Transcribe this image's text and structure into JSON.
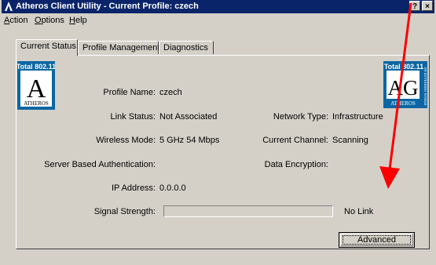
{
  "window": {
    "title": "Atheros Client Utility - Current Profile: czech",
    "help_btn": "?",
    "close_btn": "×"
  },
  "menu": [
    {
      "label_u": "A",
      "label_rest": "ction"
    },
    {
      "label_u": "O",
      "label_rest": "ptions"
    },
    {
      "label_u": "H",
      "label_rest": "elp"
    }
  ],
  "tabs": [
    "Current Status",
    "Profile Management",
    "Diagnostics"
  ],
  "status": {
    "profile_name_label": "Profile Name:",
    "profile_name_value": "czech",
    "link_status_label": "Link Status:",
    "link_status_value": "Not Associated",
    "network_type_label": "Network Type:",
    "network_type_value": "Infrastructure",
    "wireless_mode_label": "Wireless Mode:",
    "wireless_mode_value": "5 GHz 54 Mbps",
    "current_channel_label": "Current Channel:",
    "current_channel_value": "Scanning",
    "server_auth_label": "Server Based Authentication:",
    "data_encryption_label": "Data Encryption:",
    "ip_address_label": "IP Address:",
    "ip_address_value": "0.0.0.0",
    "signal_strength_label": "Signal Strength:",
    "signal_strength_value": "No Link",
    "signal_strength_fraction": 0
  },
  "buttons": {
    "advanced": "Advanced"
  },
  "logos": {
    "left_top": "Total 802.11",
    "left_big": "A",
    "left_bottom": "ATHEROS",
    "right_top": "Total 802.11",
    "right_big": "AG",
    "right_bottom": "ATHEROS",
    "right_side": "XR EXTENDED RANGE"
  },
  "colors": {
    "titlebar": "#0a246a",
    "window": "#d4d0c8",
    "logo_blue": "#0b66a3",
    "annotation_red": "#ff0000"
  }
}
